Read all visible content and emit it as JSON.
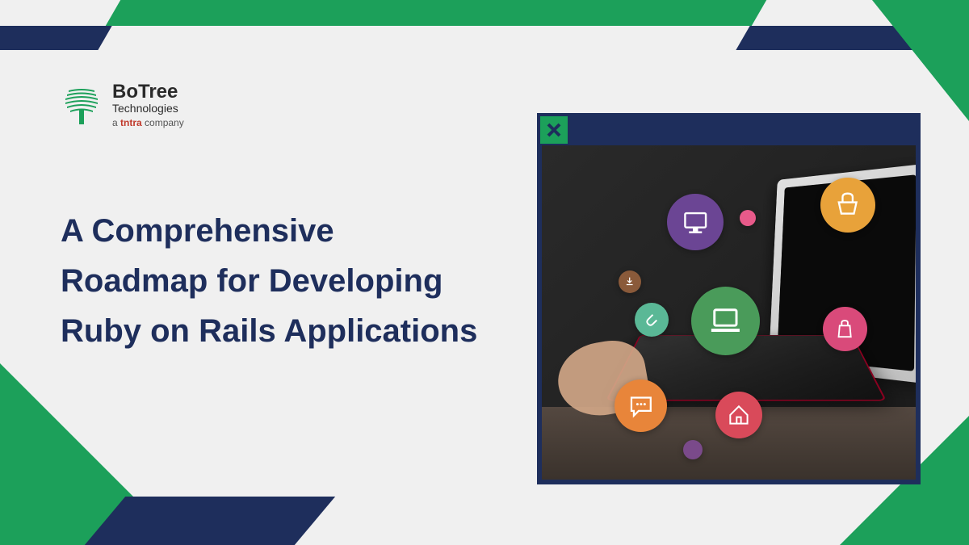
{
  "colors": {
    "green": "#1ca05a",
    "navy": "#1e2e5c",
    "background": "#f0f0f0"
  },
  "logo": {
    "brand": "BoTree",
    "subtext": "Technologies",
    "tagline_prefix": "a ",
    "tagline_red": "tntra",
    "tagline_suffix": " company"
  },
  "title": "A Comprehensive Roadmap for Developing Ruby on Rails Applications",
  "image_panel": {
    "close_icon": "close-x",
    "bubbles": [
      {
        "name": "monitor-icon",
        "color": "#6b4594"
      },
      {
        "name": "dot-icon",
        "color": "#e85a8a"
      },
      {
        "name": "basket-icon",
        "color": "#e8a23a"
      },
      {
        "name": "download-icon",
        "color": "#8a5a3a"
      },
      {
        "name": "clip-icon",
        "color": "#5ab896"
      },
      {
        "name": "laptop-icon",
        "color": "#4a9b5a"
      },
      {
        "name": "bag-icon",
        "color": "#d94a7a"
      },
      {
        "name": "chat-icon",
        "color": "#e8853a"
      },
      {
        "name": "home-icon",
        "color": "#d94a5a"
      },
      {
        "name": "dot2-icon",
        "color": "#7a4a8a"
      }
    ]
  }
}
